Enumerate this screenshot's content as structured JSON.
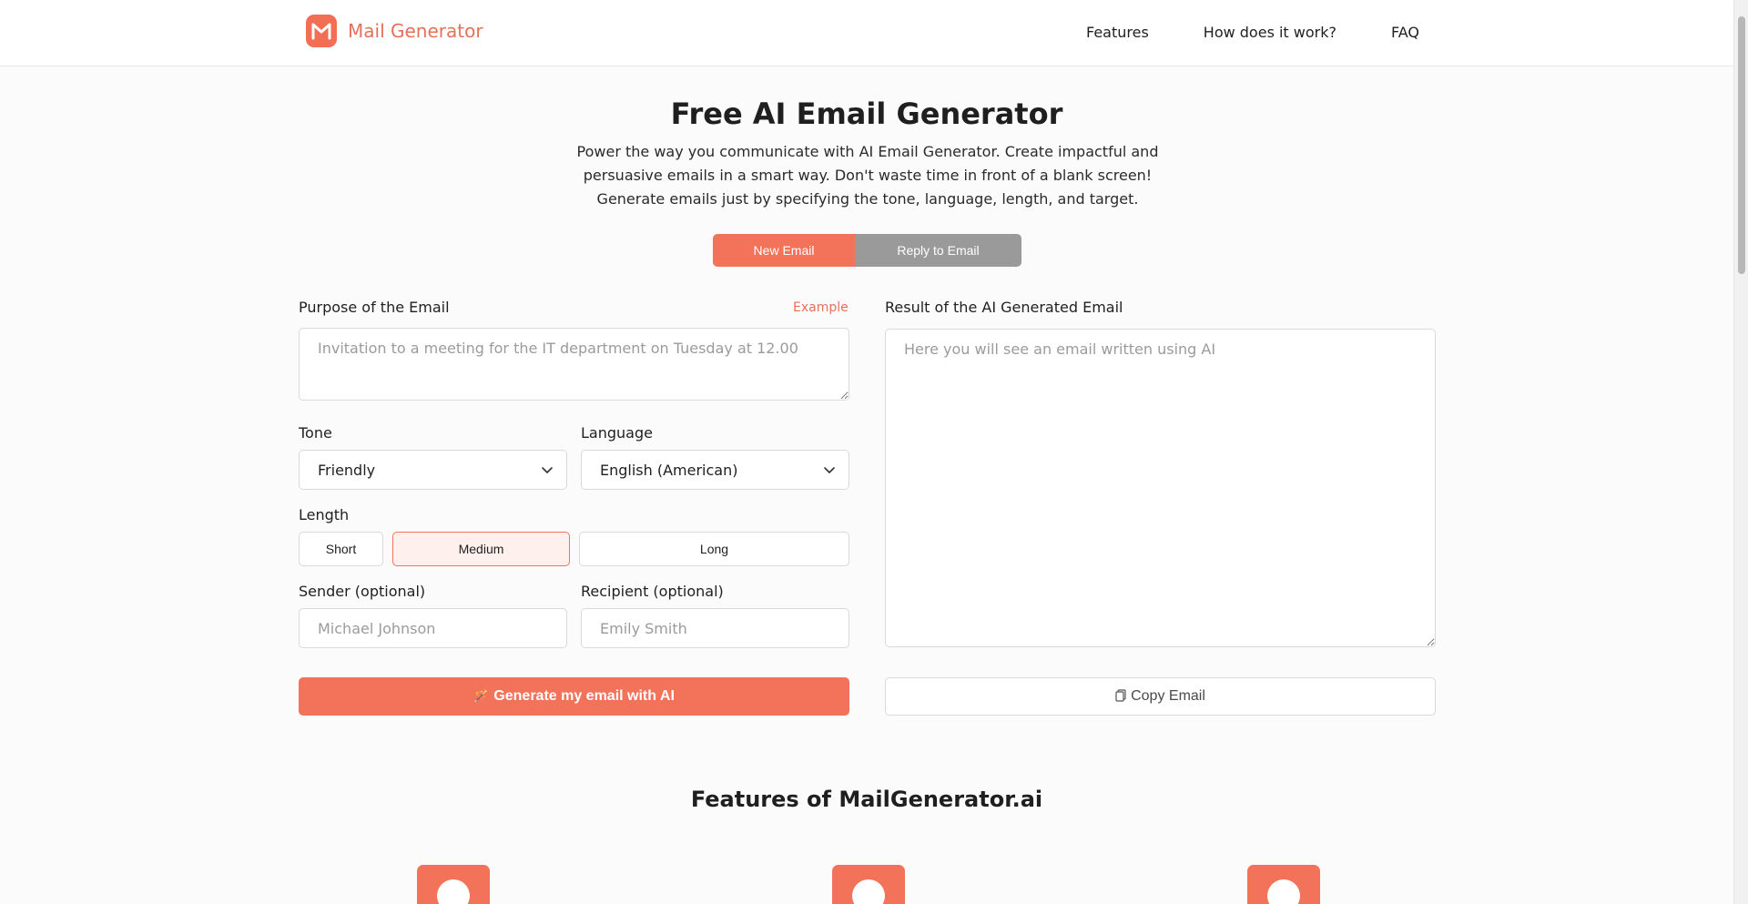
{
  "colors": {
    "accent": "#f2735a",
    "accent_text": "#e8705a",
    "inactive_toggle": "#9a9a9a",
    "active_length_bg": "#fdf0ed"
  },
  "header": {
    "brand": "Mail Generator",
    "logo_icon": "mail-logo-icon",
    "nav": [
      "Features",
      "How does it work?",
      "FAQ"
    ]
  },
  "hero": {
    "title": "Free AI Email Generator",
    "subtitle": "Power the way you communicate with AI Email Generator. Create impactful and persuasive emails in a smart way. Don't waste time in front of a blank screen! Generate emails just by specifying the tone, language, length, and target."
  },
  "mode": {
    "new_label": "New Email",
    "reply_label": "Reply to Email",
    "selected": "New Email"
  },
  "form": {
    "purpose_label": "Purpose of the Email",
    "example_link": "Example",
    "purpose_placeholder": "Invitation to a meeting for the IT department on Tuesday at 12.00",
    "tone_label": "Tone",
    "tone_value": "Friendly",
    "language_label": "Language",
    "language_value": "English (American)",
    "length_label": "Length",
    "length_options": [
      "Short",
      "Medium",
      "Long"
    ],
    "length_selected": "Medium",
    "sender_label": "Sender (optional)",
    "sender_placeholder": "Michael Johnson",
    "recipient_label": "Recipient (optional)",
    "recipient_placeholder": "Emily Smith",
    "generate_label": "Generate my email with AI",
    "generate_icon": "magic-wand-icon"
  },
  "result": {
    "label": "Result of the AI Generated Email",
    "placeholder": "Here you will see an email written using AI",
    "copy_label": "Copy Email",
    "copy_icon": "clipboard-icon"
  },
  "features": {
    "title": "Features of MailGenerator.ai",
    "icons": [
      "tag-icon",
      "camera-icon",
      "restaurant-icon"
    ]
  }
}
